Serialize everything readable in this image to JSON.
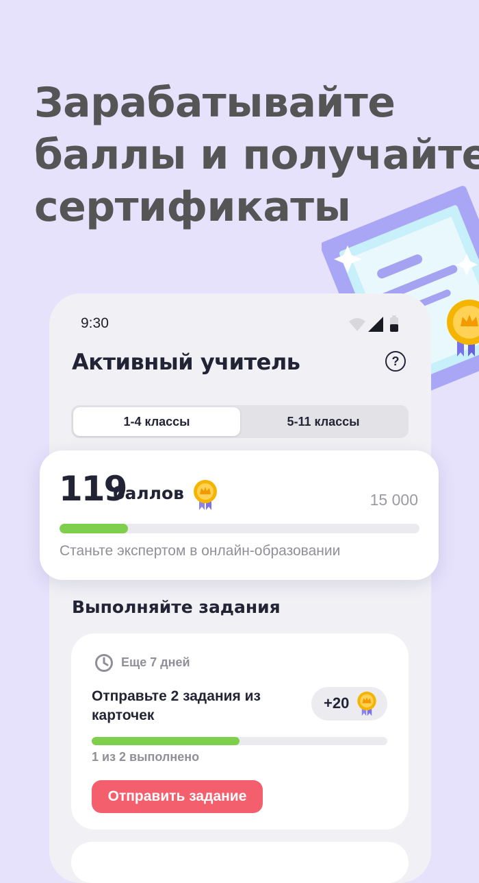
{
  "headline": [
    "Зарабатывайте",
    "баллы и получайте",
    "сертификаты"
  ],
  "status_bar": {
    "time": "9:30"
  },
  "app": {
    "title": "Активный учитель",
    "help_label": "?"
  },
  "tabs": [
    {
      "label": "1-4 классы",
      "active": true
    },
    {
      "label": "5-11 классы",
      "active": false
    }
  ],
  "points": {
    "value": "119",
    "unit": "баллов",
    "goal": "15 000",
    "progress_fraction": 0.19,
    "subtitle": "Станьте экспертом в онлайн-образовании"
  },
  "tasks_section": {
    "title": "Выполняйте задания"
  },
  "task": {
    "deadline": "Еще 7 дней",
    "text": "Отправьте 2 задания из карточек",
    "reward": "+20",
    "progress_fraction": 0.5,
    "progress_text": "1 из 2 выполнено",
    "button": "Отправить задание"
  },
  "colors": {
    "background": "#e6e2fc",
    "accent_green": "#7ecf4c",
    "button_red": "#f35f6d",
    "medal_gold": "#f4b400",
    "medal_ribbon": "#8d84ea"
  },
  "icons": [
    "certificate-illustration",
    "wifi-icon",
    "signal-icon",
    "battery-icon",
    "help-icon",
    "medal-icon",
    "clock-icon"
  ]
}
